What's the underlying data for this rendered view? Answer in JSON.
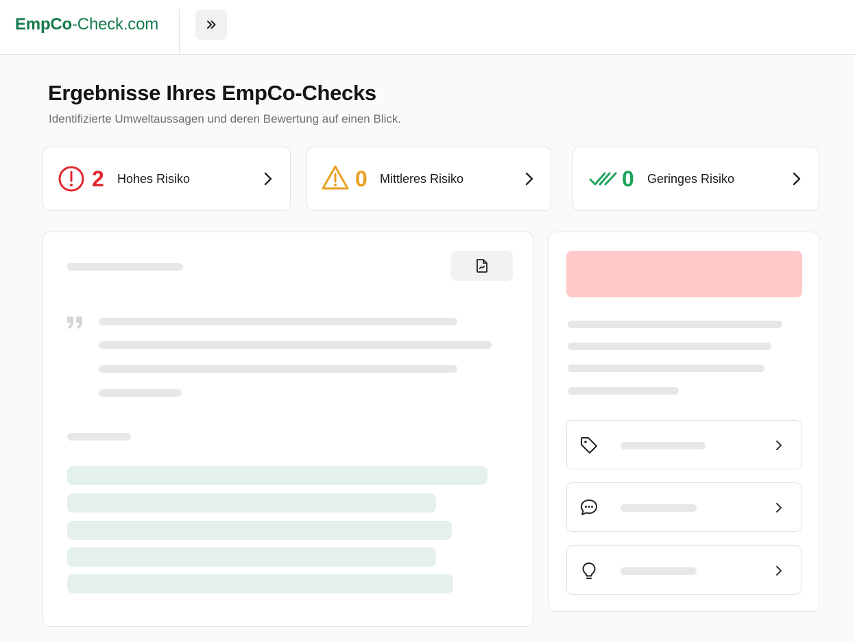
{
  "app": {
    "logo_bold": "EmpCo",
    "logo_rest": "-Check.com"
  },
  "header": {
    "title": "Ergebnisse Ihres EmpCo-Checks",
    "subtitle": "Identifizierte Umweltaussagen und deren Bewertung auf einen Blick."
  },
  "risks": [
    {
      "count": "2",
      "label": "Hohes Risiko",
      "color": "#e0262b",
      "icon": "alert-circle-icon"
    },
    {
      "count": "0",
      "label": "Mittleres Risiko",
      "color": "#e9a024",
      "icon": "warning-triangle-icon"
    },
    {
      "count": "0",
      "label": "Geringes Risiko",
      "color": "#1ea35a",
      "icon": "double-check-icon"
    }
  ],
  "colors": {
    "brand": "#137a4a",
    "alert_block": "#ffc9c9",
    "skeleton": "#e7e7e7",
    "skeleton_green": "#e3f1ea"
  },
  "details_items": [
    {
      "icon": "tag-icon"
    },
    {
      "icon": "chat-bubble-icon"
    },
    {
      "icon": "lightbulb-icon"
    }
  ]
}
